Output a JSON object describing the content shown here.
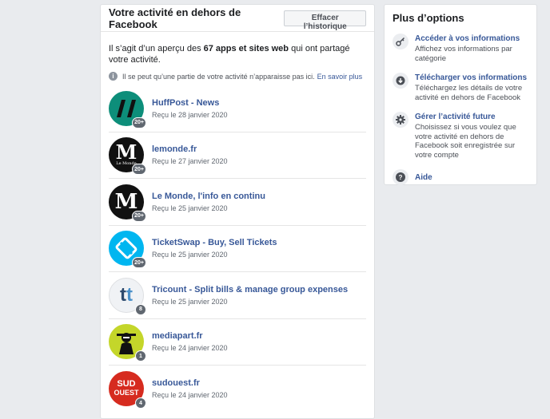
{
  "main": {
    "title": "Votre activité en dehors de Facebook",
    "clear_button": "Effacer l’historique",
    "intro": {
      "prefix": "Il s’agit d’un aperçu des ",
      "bold": "67 apps et sites web",
      "suffix": " qui ont partagé votre activité."
    },
    "note": {
      "icon": "i",
      "text": "Il se peut qu’une partie de votre activité n’apparaisse pas ici.",
      "link": "En savoir plus"
    },
    "apps": [
      {
        "name": "HuffPost - News",
        "date": "Reçu le 28 janvier 2020",
        "badge": "20+",
        "icon": "huffpost-logo-icon"
      },
      {
        "name": "lemonde.fr",
        "date": "Reçu le 27 janvier 2020",
        "badge": "20+",
        "icon": "lemonde-logo-icon"
      },
      {
        "name": "Le Monde, l'info en continu",
        "date": "Reçu le 25 janvier 2020",
        "badge": "20+",
        "icon": "lemonde-app-logo-icon"
      },
      {
        "name": "TicketSwap - Buy, Sell Tickets",
        "date": "Reçu le 25 janvier 2020",
        "badge": "20+",
        "icon": "ticketswap-logo-icon"
      },
      {
        "name": "Tricount - Split bills & manage group expenses",
        "date": "Reçu le 25 janvier 2020",
        "badge": "8",
        "icon": "tricount-logo-icon"
      },
      {
        "name": "mediapart.fr",
        "date": "Reçu le 24 janvier 2020",
        "badge": "1",
        "icon": "mediapart-logo-icon"
      },
      {
        "name": "sudouest.fr",
        "date": "Reçu le 24 janvier 2020",
        "badge": "4",
        "icon": "sudouest-logo-icon"
      }
    ],
    "logo_text": {
      "lemonde": "M",
      "lemonde_small": "Le Monde",
      "tricount": "t",
      "sudouest_1": "SUD",
      "sudouest_2": "OUEST"
    }
  },
  "side": {
    "title": "Plus d’options",
    "options": [
      {
        "title": "Accéder à vos informations",
        "desc": "Affichez vos informations par catégorie",
        "icon": "key-icon"
      },
      {
        "title": "Télécharger vos informations",
        "desc": "Téléchargez les détails de votre activité en dehors de Facebook",
        "icon": "download-icon"
      },
      {
        "title": "Gérer l’activité future",
        "desc": "Choisissez si vous voulez que votre activité en dehors de Facebook soit enregistrée sur votre compte",
        "icon": "gear-icon"
      },
      {
        "title": "Aide",
        "desc": "",
        "icon": "help-icon",
        "glyph": "?"
      }
    ]
  },
  "colors": {
    "link": "#385898",
    "background": "#e9ebee",
    "huffpost": "#0d8e7a",
    "ticketswap": "#00b6f0",
    "mediapart": "#c4d62a",
    "sudouest": "#d62b1f"
  }
}
